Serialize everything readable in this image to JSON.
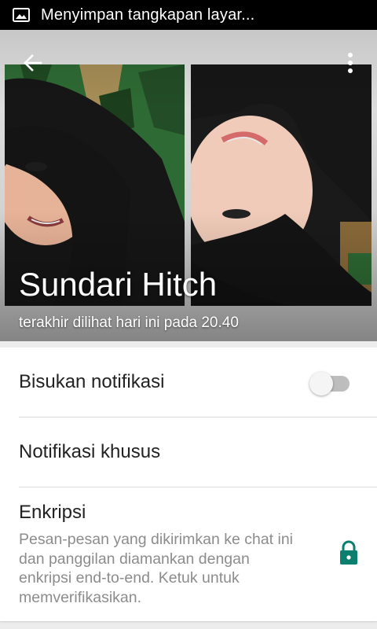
{
  "status_bar": {
    "notification_text": "Menyimpan tangkapan layar...",
    "icon": "image-icon"
  },
  "contact": {
    "name": "Sundari Hitch",
    "last_seen": "terakhir dilihat hari ini pada 20.40"
  },
  "toolbar": {
    "back_icon": "arrow-back-icon",
    "menu_icon": "more-vert-icon"
  },
  "settings": {
    "mute": {
      "label": "Bisukan notifikasi",
      "enabled": false
    },
    "custom": {
      "label": "Notifikasi khusus"
    },
    "encryption": {
      "label": "Enkripsi",
      "description": "Pesan-pesan yang dikirimkan ke chat ini dan panggilan diamankan dengan enkripsi end-to-end. Ketuk untuk memverifikasikan.",
      "icon": "lock-icon"
    }
  },
  "colors": {
    "accent": "#075e54",
    "status_bar": "#000000",
    "primary_text": "#222222",
    "secondary_text": "#8c8c8c"
  }
}
